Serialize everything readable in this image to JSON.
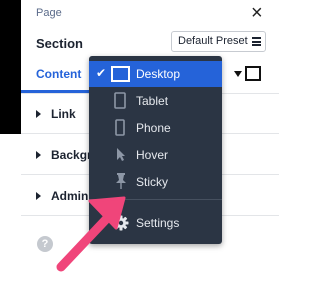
{
  "header": {
    "breadcrumb": "Page",
    "section_title": "Section",
    "preset_button": "Default Preset"
  },
  "tabs": {
    "active": "Content"
  },
  "rows": [
    {
      "label": "Link"
    },
    {
      "label": "Backgro"
    },
    {
      "label": "Admin L"
    }
  ],
  "help_icon": "?",
  "device_menu": {
    "items": [
      {
        "label": "Desktop",
        "icon": "desktop-icon",
        "selected": true
      },
      {
        "label": "Tablet",
        "icon": "tablet-icon"
      },
      {
        "label": "Phone",
        "icon": "phone-icon"
      },
      {
        "label": "Hover",
        "icon": "cursor-icon"
      },
      {
        "label": "Sticky",
        "icon": "pin-icon"
      }
    ],
    "settings_label": "Settings"
  },
  "colors": {
    "accent": "#2563d9",
    "menu_bg": "#2b3544",
    "annotation_arrow": "#f0457a"
  }
}
